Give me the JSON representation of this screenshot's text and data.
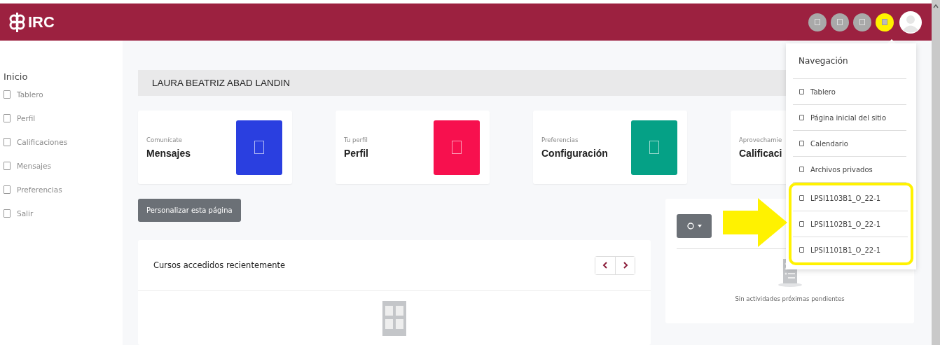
{
  "header": {
    "logo": "IRC",
    "icons": [
      {
        "selected": false
      },
      {
        "selected": false
      },
      {
        "selected": false
      },
      {
        "selected": true
      }
    ]
  },
  "sidebar": {
    "title": "Inicio",
    "items": [
      {
        "label": "Tablero"
      },
      {
        "label": "Perfil"
      },
      {
        "label": "Calificaciones"
      },
      {
        "label": "Mensajes"
      },
      {
        "label": "Preferencias"
      },
      {
        "label": "Salir"
      }
    ]
  },
  "user_name": "LAURA BEATRIZ ABAD LANDIN",
  "cards": [
    {
      "caption": "Comunícate",
      "title": "Mensajes",
      "color": "#2a3fe0"
    },
    {
      "caption": "Tu perfil",
      "title": "Perfil",
      "color": "#f7104e"
    },
    {
      "caption": "Preferencias",
      "title": "Configuración",
      "color": "#05a186"
    },
    {
      "caption": "Aprovechamie",
      "title": "Calificaci"
    }
  ],
  "customize_button": "Personalizar esta página",
  "recent_courses": {
    "title": "Cursos accedidos recientemente"
  },
  "timeline": {
    "empty_text": "Sin actividades próximas pendientes"
  },
  "dropdown": {
    "title": "Navegación",
    "items": [
      {
        "label": "Tablero",
        "highlighted": false
      },
      {
        "label": "Página inicial del sitio",
        "highlighted": false
      },
      {
        "label": "Calendario",
        "highlighted": false
      },
      {
        "label": "Archivos privados",
        "highlighted": false
      },
      {
        "label": "LPSI1103B1_O_22-1",
        "highlighted": true
      },
      {
        "label": "LPSI1102B1_O_22-1",
        "highlighted": true
      },
      {
        "label": "LPSI1101B1_O_22-1",
        "highlighted": true
      }
    ]
  }
}
